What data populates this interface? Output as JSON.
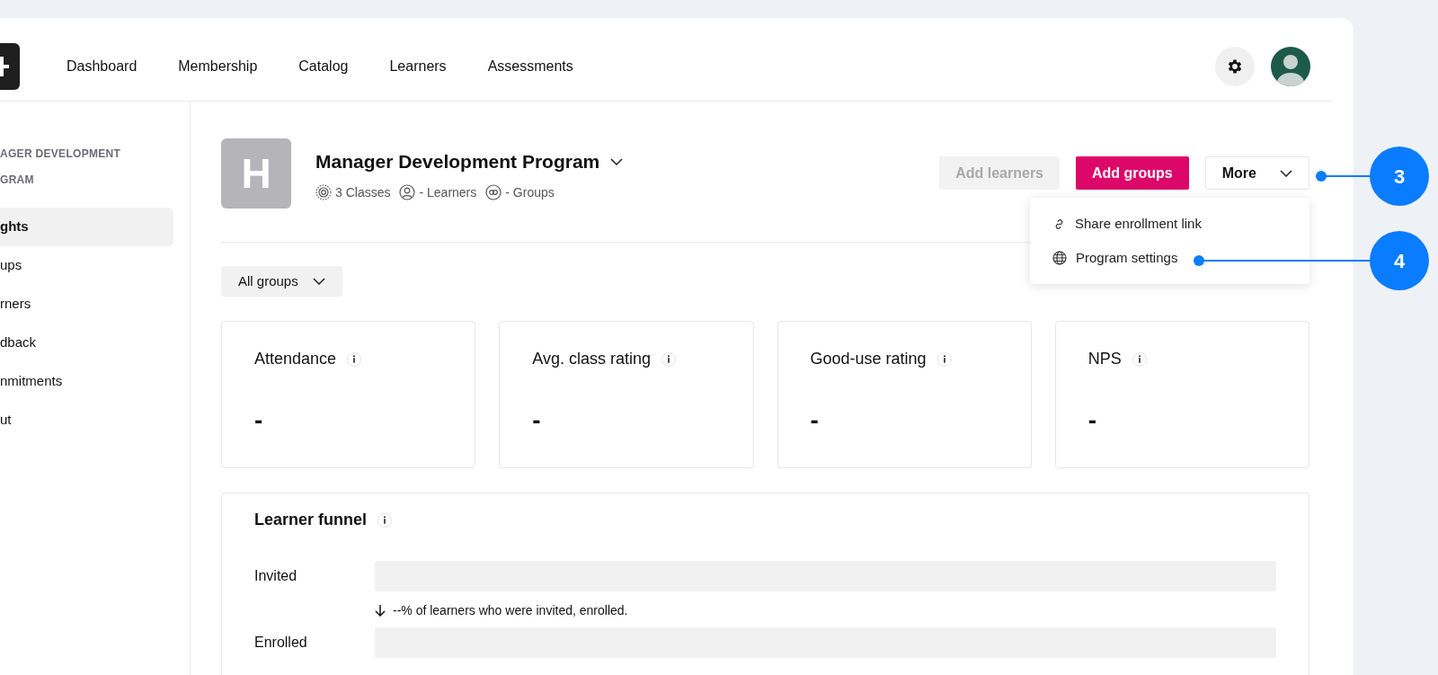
{
  "nav": [
    {
      "label": "Dashboard",
      "selected": false
    },
    {
      "label": "Membership",
      "selected": false
    },
    {
      "label": "Catalog",
      "selected": false
    },
    {
      "label": "Learners",
      "selected": false
    },
    {
      "label": "Assessments",
      "selected": false
    }
  ],
  "sidebar": {
    "heading": [
      "AGER DEVELOPMENT",
      "GRAM"
    ],
    "items": [
      {
        "label": "ghts",
        "selected": true
      },
      {
        "label": "ups",
        "selected": false
      },
      {
        "label": "rners",
        "selected": false
      },
      {
        "label": "dback",
        "selected": false
      },
      {
        "label": "nmitments",
        "selected": false
      },
      {
        "label": "ut",
        "selected": false
      }
    ]
  },
  "program": {
    "logo_letter": "H",
    "title": "Manager Development Program",
    "stats": [
      {
        "kind": "classes",
        "text": "3 Classes"
      },
      {
        "kind": "learners",
        "text": "- Learners"
      },
      {
        "kind": "groups",
        "text": "- Groups"
      }
    ]
  },
  "actions": [
    {
      "label": "Add learners",
      "kind": "secondary",
      "disabled": true
    },
    {
      "label": "Add groups",
      "kind": "primary",
      "disabled": false
    },
    {
      "label": "More",
      "kind": "dropdown",
      "disabled": false
    }
  ],
  "more_menu": [
    {
      "kind": "link",
      "label": "Share enrollment link"
    },
    {
      "kind": "globe",
      "label": "Program settings"
    }
  ],
  "filter": {
    "label": "All groups"
  },
  "metrics": [
    {
      "title": "Attendance",
      "value": "-"
    },
    {
      "title": "Avg. class rating",
      "value": "-"
    },
    {
      "title": "Good-use rating",
      "value": "-"
    },
    {
      "title": "NPS",
      "value": "-"
    }
  ],
  "funnel": {
    "title": "Learner funnel",
    "rows": [
      {
        "label": "Invited"
      },
      {
        "label": "Enrolled"
      }
    ],
    "notes": [
      "--% of learners who were invited, enrolled."
    ]
  },
  "callouts": [
    {
      "number": "3"
    },
    {
      "number": "4"
    }
  ]
}
